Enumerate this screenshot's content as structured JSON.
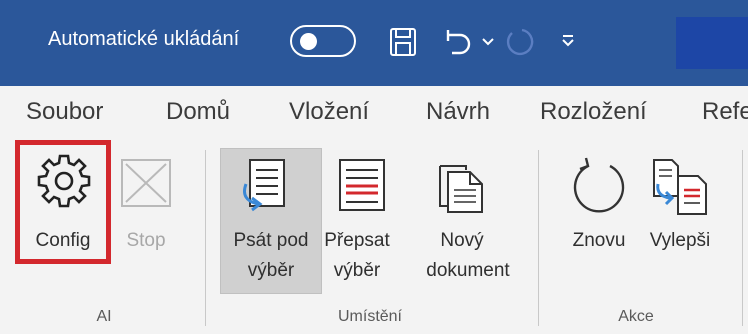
{
  "titlebar": {
    "autosave_label": "Automatické ukládání",
    "toggle_state": "off",
    "accent": "#2b579a"
  },
  "menu": {
    "tabs": [
      "Soubor",
      "Domů",
      "Vložení",
      "Návrh",
      "Rozložení",
      "Refe"
    ]
  },
  "ribbon": {
    "groups": [
      {
        "label": "AI",
        "buttons": [
          {
            "label": "Config",
            "icon": "gear-icon",
            "enabled": true,
            "highlighted": true
          },
          {
            "label": "Stop",
            "icon": "stop-icon",
            "enabled": false
          }
        ]
      },
      {
        "label": "Umístění",
        "buttons": [
          {
            "label_line1": "Psát pod",
            "label_line2": "výběr",
            "icon": "insert-below-icon",
            "selected": true
          },
          {
            "label_line1": "Přepsat",
            "label_line2": "výběr",
            "icon": "overwrite-icon"
          },
          {
            "label_line1": "Nový",
            "label_line2": "dokument",
            "icon": "new-document-icon"
          }
        ]
      },
      {
        "label": "Akce",
        "buttons": [
          {
            "label": "Znovu",
            "icon": "refresh-icon"
          },
          {
            "label": "Vylepši",
            "icon": "improve-icon"
          }
        ]
      }
    ]
  },
  "colors": {
    "highlight_border": "#d3282d",
    "selected_bg": "#d0d0d0"
  }
}
